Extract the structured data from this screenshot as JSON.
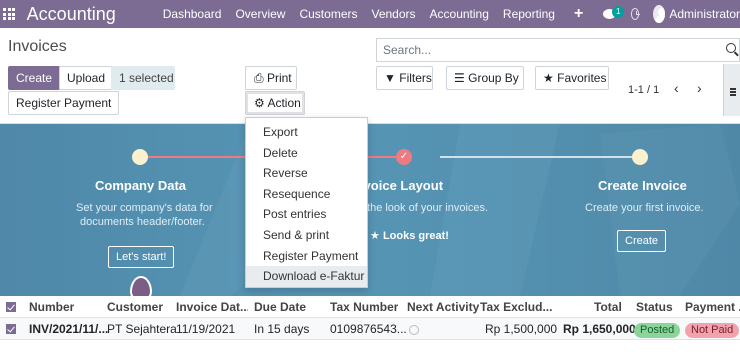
{
  "nav": {
    "app_title": "Accounting",
    "menu": [
      "Dashboard",
      "Overview",
      "Customers",
      "Vendors",
      "Accounting",
      "Reporting"
    ],
    "plus": "+",
    "chat_badge": "1",
    "user": "Administrator"
  },
  "control": {
    "title": "Invoices",
    "create": "Create",
    "upload": "Upload",
    "selected": "1 selected",
    "register_payment": "Register Payment",
    "print": "Print",
    "action": "Action",
    "search_placeholder": "Search...",
    "filters": "Filters",
    "group_by": "Group By",
    "favorites": "Favorites",
    "pager": "1-1 / 1",
    "pager_prev": "‹",
    "pager_next": "›"
  },
  "action_menu": [
    "Export",
    "Delete",
    "Reverse",
    "Resequence",
    "Post entries",
    "Send & print",
    "Register Payment",
    "Download e-Faktur"
  ],
  "onboarding": {
    "step1": {
      "title": "Company Data",
      "desc1": "Set your company's data for",
      "desc2": "documents header/footer.",
      "button": "Let's start!"
    },
    "step2": {
      "title": "Invoice Layout",
      "desc1": "Customize the look of your invoices.",
      "done": "Looks great!"
    },
    "step3": {
      "title": "Create Invoice",
      "desc1": "Create your first invoice.",
      "button": "Create"
    }
  },
  "table": {
    "headers": [
      "Number",
      "Customer",
      "Invoice Dat...",
      "Due Date",
      "Tax Number",
      "Next Activity",
      "Tax Exclud...",
      "Total",
      "Status",
      "Payment ..."
    ],
    "rows": [
      {
        "number": "INV/2021/11/...",
        "customer": "PT Sejahtera",
        "invoice_date": "11/19/2021",
        "due_date": "In 15 days",
        "tax_number": "0109876543...",
        "tax_excluded": "Rp 1,500,000",
        "total": "Rp 1,650,000",
        "status": "Posted",
        "payment": "Not Paid"
      }
    ]
  },
  "colors": {
    "brand": "#7c6b93",
    "accent_teal": "#00a09d",
    "banner": "#5796b6",
    "posted": "#8bd49a",
    "not_paid": "#f0a3ad"
  }
}
